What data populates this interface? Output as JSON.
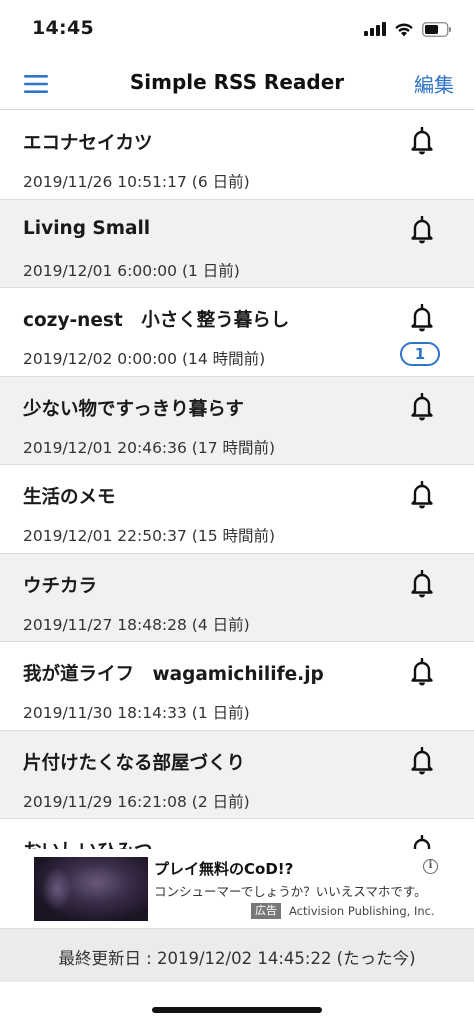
{
  "status_bar": {
    "time": "14:45",
    "icons": [
      "cellular-signal-icon",
      "wifi-icon",
      "battery-icon"
    ]
  },
  "nav": {
    "title": "Simple RSS Reader",
    "edit_label": "編集",
    "menu_icon": "hamburger-menu-icon"
  },
  "feeds": [
    {
      "title": "エコナセイカツ",
      "date": "2019/11/26 10:51:17 (6 日前)"
    },
    {
      "title": "Living Small",
      "date": "2019/12/01 6:00:00 (1 日前)"
    },
    {
      "title": "cozy-nest　小さく整う暮らし",
      "date": "2019/12/02 0:00:00 (14 時間前)",
      "unread": "1"
    },
    {
      "title": "少ない物ですっきり暮らす",
      "date": "2019/12/01 20:46:36 (17 時間前)"
    },
    {
      "title": "生活のメモ",
      "date": "2019/12/01 22:50:37 (15 時間前)"
    },
    {
      "title": "ウチカラ",
      "date": "2019/11/27 18:48:28 (4 日前)"
    },
    {
      "title": "我が道ライフ　wagamichilife.jp",
      "date": "2019/11/30 18:14:33 (1 日前)"
    },
    {
      "title": "片付けたくなる部屋づくり",
      "date": "2019/11/29 16:21:08 (2 日前)"
    },
    {
      "title": "おいしいひみつ",
      "date": ""
    }
  ],
  "ad": {
    "title": "プレイ無料のCoD!?",
    "description": "コンシューマーでしょうか？いいえスマホです。",
    "tag": "広告",
    "advertiser": "Activision Publishing, Inc.",
    "info_icon": "info-icon"
  },
  "footer": {
    "last_updated": "最終更新日 : 2019/12/02 14:45:22 (たった今)"
  },
  "colors": {
    "accent": "#2f74c8",
    "row_alt": "#f1f1f3",
    "footer_bg": "#ebebee"
  }
}
